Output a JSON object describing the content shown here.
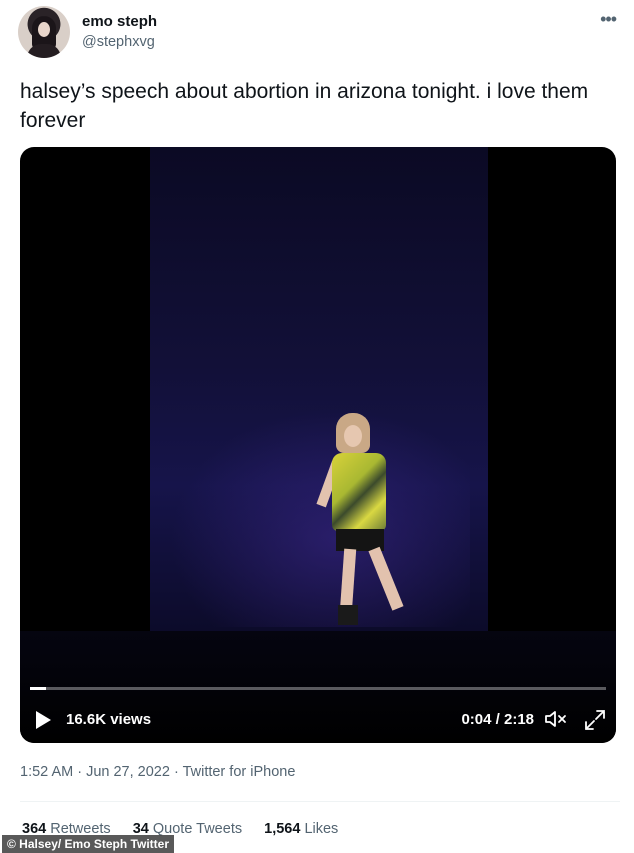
{
  "author": {
    "display_name": "emo steph",
    "handle": "@stephxvg"
  },
  "tweet": {
    "text": "halsey’s speech about abortion in arizona tonight. i love them forever"
  },
  "video": {
    "views_label": "16.6K views",
    "time_label": "0:04 / 2:18",
    "progress_fraction": 0.028,
    "icons": [
      "play-icon",
      "mute-icon",
      "fullscreen-icon"
    ]
  },
  "meta": {
    "timestamp": "1:52 AM · Jun 27, 2022",
    "separator": " · ",
    "source": "Twitter for iPhone"
  },
  "stats": {
    "retweets": "364",
    "retweets_label": "Retweets",
    "quote_tweets": "34",
    "quote_tweets_label": "Quote Tweets",
    "likes": "1,564",
    "likes_label": "Likes"
  },
  "credit": "© Halsey/ Emo Steph Twitter",
  "more_icon": "more-horizontal-icon",
  "colors": {
    "text_primary": "#0f1419",
    "text_secondary": "#536471"
  }
}
